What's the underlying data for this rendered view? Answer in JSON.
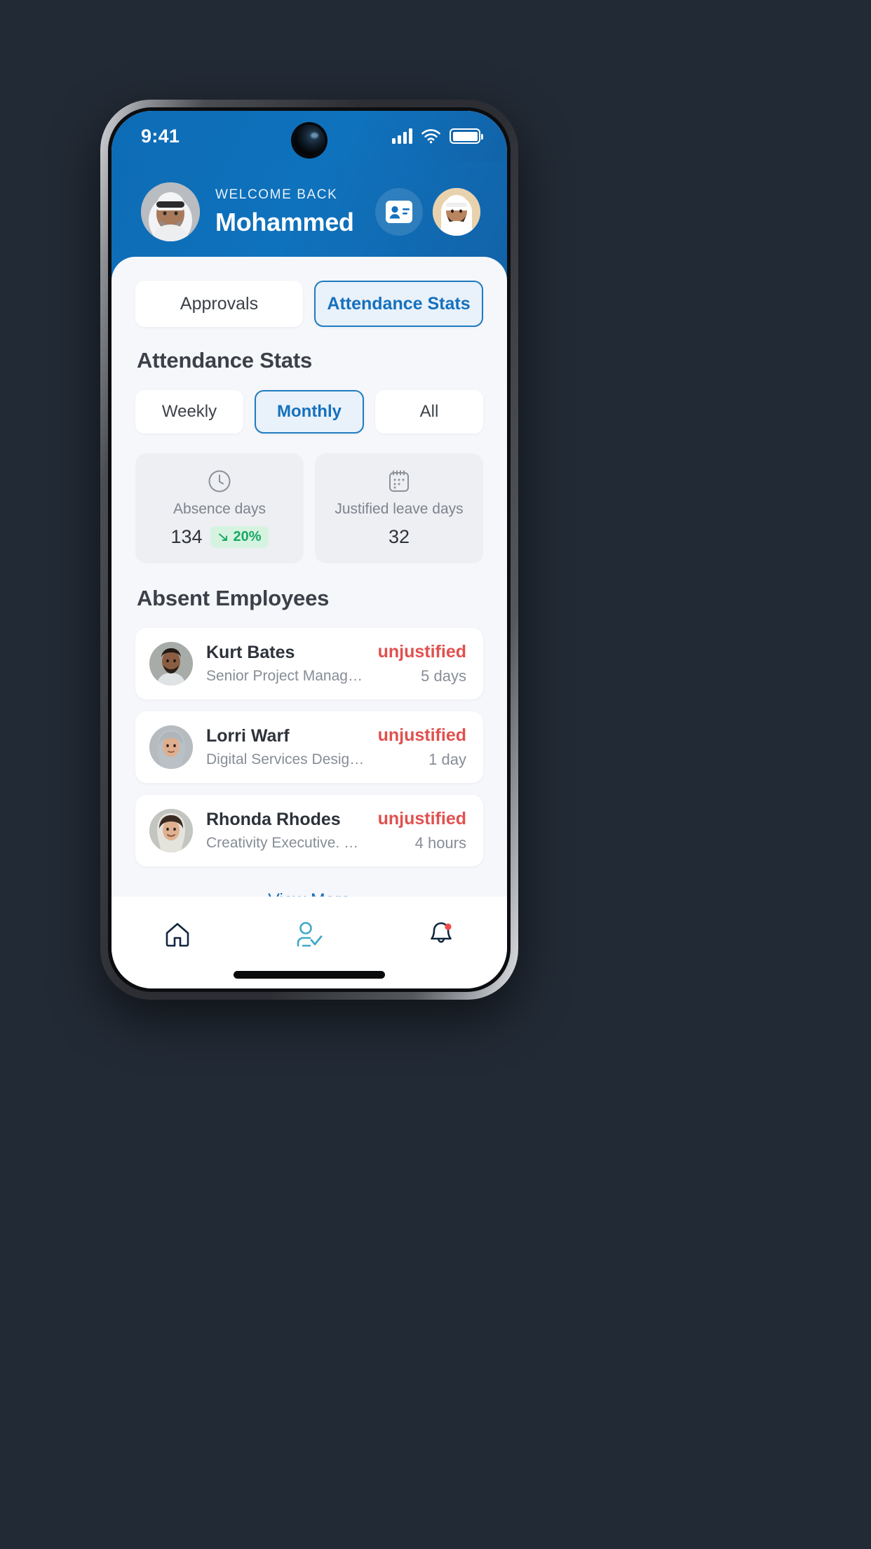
{
  "theme": {
    "page_background": "#222a35",
    "header_blue": "#0f72bd",
    "accent_blue": "#1570bd",
    "sheet_background": "#f6f7fb",
    "danger_red": "#e0514f",
    "success_green": "#19a863",
    "nav_active": "#3fa9c9",
    "nav_inactive": "#12263f"
  },
  "status_bar": {
    "time": "9:41",
    "signal_icon": "signal-bars-icon",
    "wifi_icon": "wifi-icon",
    "battery_icon": "battery-full-icon",
    "camera_icon": "front-camera-icon"
  },
  "header": {
    "avatar_icon": "user-avatar-photo",
    "welcome_label": "WELCOME BACK",
    "user_name": "Mohammed",
    "actions": [
      {
        "icon": "id-card-icon",
        "name": "id-card-button"
      },
      {
        "icon": "profile-avatar-icon",
        "name": "profile-avatar-button"
      }
    ]
  },
  "tabs": [
    {
      "label": "Approvals",
      "active": false
    },
    {
      "label": "Attendance Stats",
      "active": true
    }
  ],
  "main": {
    "section_title": "Attendance Stats",
    "filters": [
      {
        "label": "Weekly",
        "active": false
      },
      {
        "label": "Monthly",
        "active": true
      },
      {
        "label": "All",
        "active": false
      }
    ],
    "stat_cards": [
      {
        "icon": "clock-icon",
        "label": "Absence days",
        "value": "134",
        "trend_value": "20%",
        "trend_icon": "arrow-down-right-icon",
        "trend_direction": "down"
      },
      {
        "icon": "calendar-icon",
        "label": "Justified leave days",
        "value": "32",
        "trend_value": "",
        "trend_icon": "",
        "trend_direction": ""
      }
    ],
    "employees_title": "Absent Employees",
    "employees": [
      {
        "avatar": "employee-photo-male",
        "name": "Kurt Bates",
        "role": "Senior Project Manager. CHC Dept",
        "status": "unjustified",
        "duration": "5 days"
      },
      {
        "avatar": "employee-photo-female-hijab",
        "name": "Lorri Warf",
        "role": "Digital Services Designer. CHC Dept",
        "status": "unjustified",
        "duration": "1 day"
      },
      {
        "avatar": "employee-photo-female-hijab",
        "name": "Rhonda Rhodes",
        "role": "Creativity Executive. CHC Dept",
        "status": "unjustified",
        "duration": "4 hours"
      }
    ],
    "view_more_label": "View More"
  },
  "bottom_nav": [
    {
      "icon": "home-icon",
      "name": "nav-home",
      "active": false,
      "badge": false
    },
    {
      "icon": "user-check-icon",
      "name": "nav-attendance",
      "active": true,
      "badge": false
    },
    {
      "icon": "bell-icon",
      "name": "nav-notifications",
      "active": false,
      "badge": true
    }
  ]
}
